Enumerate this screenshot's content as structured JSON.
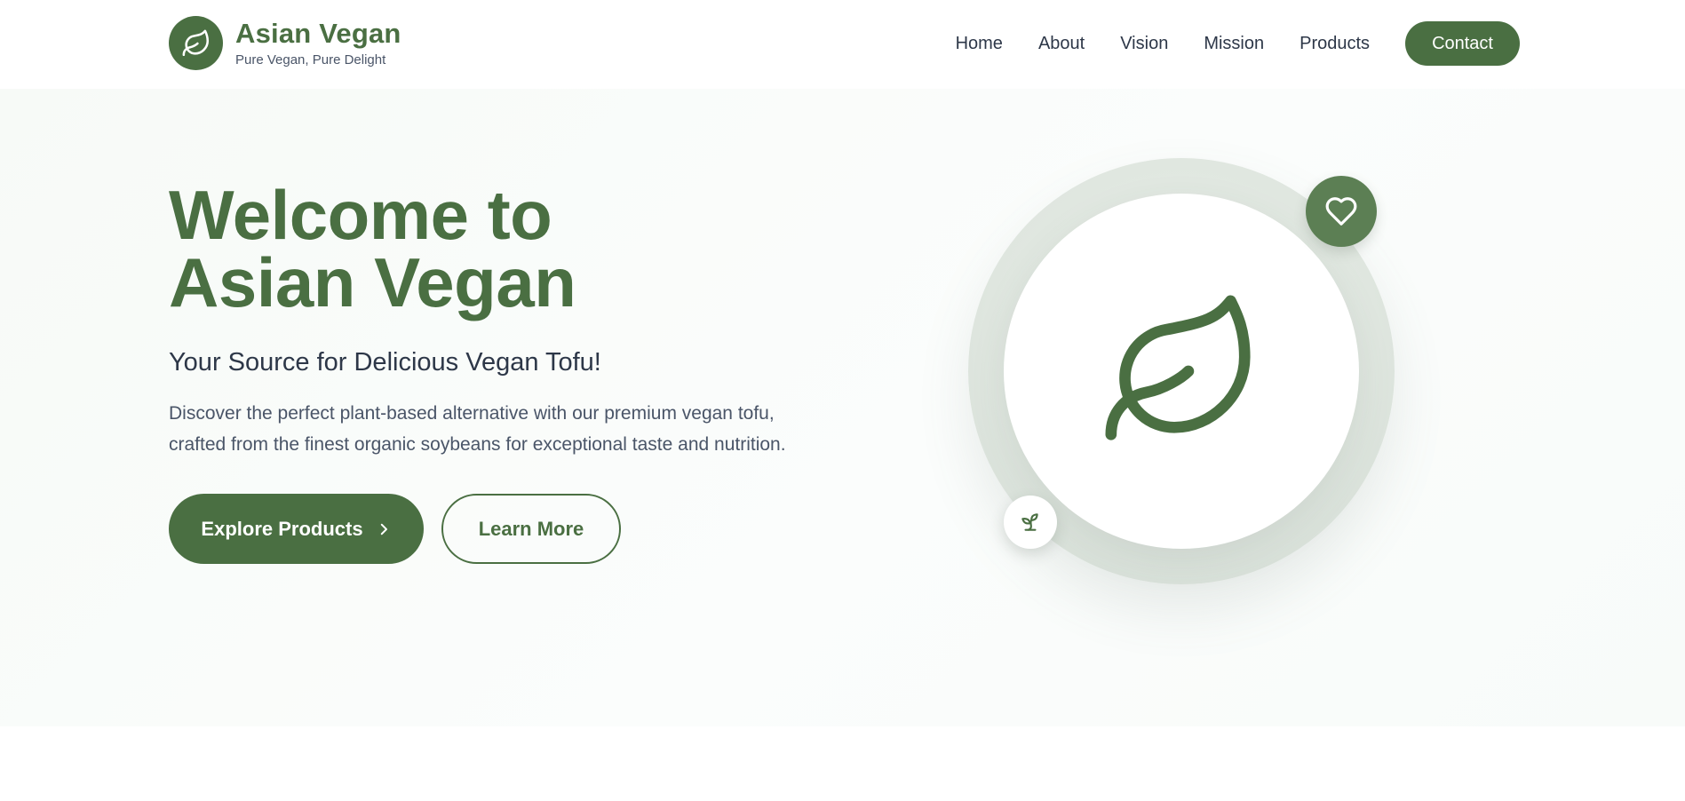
{
  "brand": {
    "name": "Asian Vegan",
    "tagline": "Pure Vegan, Pure Delight",
    "logo_icon": "leaf-icon",
    "color": "#4a6f42"
  },
  "nav": {
    "items": [
      {
        "label": "Home"
      },
      {
        "label": "About"
      },
      {
        "label": "Vision"
      },
      {
        "label": "Mission"
      },
      {
        "label": "Products"
      }
    ],
    "contact_label": "Contact"
  },
  "hero": {
    "title_line1": "Welcome to",
    "title_line2": "Asian Vegan",
    "subtitle": "Your Source for Delicious Vegan Tofu!",
    "description_line1": "Discover the perfect plant-based alternative with our premium vegan tofu,",
    "description_line2": "crafted from the finest organic soybeans for exceptional taste and nutrition.",
    "primary_button": "Explore Products",
    "primary_button_icon": "chevron-right-icon",
    "secondary_button": "Learn More"
  },
  "illustration": {
    "center_icon": "leaf-icon",
    "top_badge_icon": "heart-icon",
    "bottom_badge_icon": "sprout-icon"
  },
  "colors": {
    "accent": "#4a6f42",
    "badge": "#5c7f54",
    "text": "#2d3748",
    "muted_text": "#4a5568"
  }
}
